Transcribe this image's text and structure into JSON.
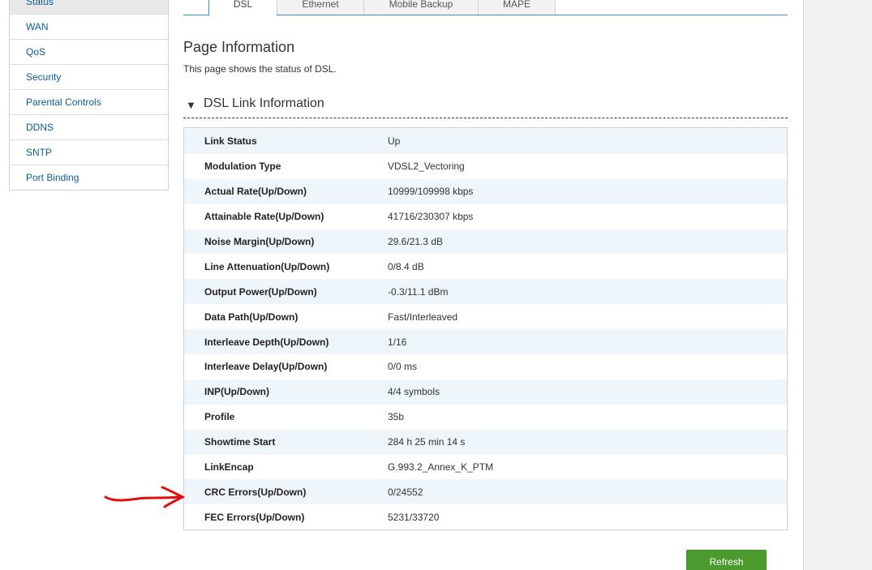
{
  "sidebar": {
    "items": [
      {
        "label": "Status"
      },
      {
        "label": "WAN"
      },
      {
        "label": "QoS"
      },
      {
        "label": "Security"
      },
      {
        "label": "Parental Controls"
      },
      {
        "label": "DDNS"
      },
      {
        "label": "SNTP"
      },
      {
        "label": "Port Binding"
      }
    ]
  },
  "tabs": [
    {
      "label": "DSL",
      "active": true
    },
    {
      "label": "Ethernet"
    },
    {
      "label": "Mobile Backup"
    },
    {
      "label": "MAPE"
    }
  ],
  "page": {
    "title": "Page Information",
    "description": "This page shows the status of DSL."
  },
  "section": {
    "title": "DSL Link Information",
    "collapse_glyph": "▼"
  },
  "dsl_info": {
    "rows": [
      {
        "label": "Link Status",
        "value": "Up"
      },
      {
        "label": "Modulation Type",
        "value": "VDSL2_Vectoring"
      },
      {
        "label": "Actual Rate(Up/Down)",
        "value": "10999/109998 kbps"
      },
      {
        "label": "Attainable Rate(Up/Down)",
        "value": "41716/230307 kbps"
      },
      {
        "label": "Noise Margin(Up/Down)",
        "value": "29.6/21.3 dB"
      },
      {
        "label": "Line Attenuation(Up/Down)",
        "value": "0/8.4 dB"
      },
      {
        "label": "Output Power(Up/Down)",
        "value": "-0.3/11.1 dBm"
      },
      {
        "label": "Data Path(Up/Down)",
        "value": "Fast/Interleaved"
      },
      {
        "label": "Interleave Depth(Up/Down)",
        "value": "1/16"
      },
      {
        "label": "Interleave Delay(Up/Down)",
        "value": "0/0 ms"
      },
      {
        "label": "INP(Up/Down)",
        "value": "4/4 symbols"
      },
      {
        "label": "Profile",
        "value": "35b"
      },
      {
        "label": "Showtime Start",
        "value": "284 h 25 min 14 s"
      },
      {
        "label": "LinkEncap",
        "value": "G.993.2_Annex_K_PTM"
      },
      {
        "label": "CRC Errors(Up/Down)",
        "value": "0/24552"
      },
      {
        "label": "FEC Errors(Up/Down)",
        "value": "5231/33720"
      }
    ]
  },
  "buttons": {
    "refresh_label": "Refresh"
  },
  "colors": {
    "link": "#0d5c91",
    "tab_border": "#3f8fc0",
    "row_alt": "#eef6fc",
    "button_green": "#4a9a2e",
    "annotation_red": "#e01010"
  },
  "icons": {
    "collapse": "triangle-down-icon",
    "annotation": "red-arrow-icon"
  }
}
